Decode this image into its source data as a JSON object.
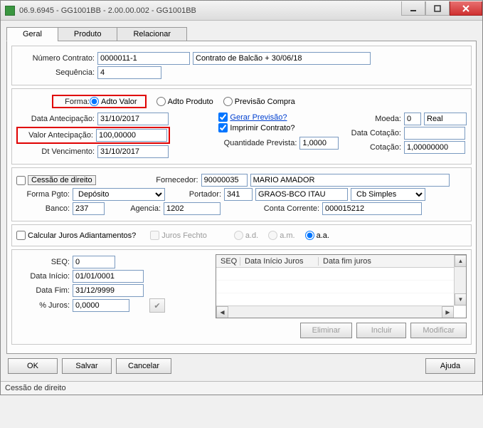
{
  "title": "06.9.6945 - GG1001BB - 2.00.00.002 - GG1001BB",
  "tabs": {
    "geral": "Geral",
    "produto": "Produto",
    "relacionar": "Relacionar"
  },
  "g1": {
    "numContratoLbl": "Número Contrato:",
    "numContrato": "0000011-1",
    "descContrato": "Contrato de Balcão + 30/06/18",
    "sequenciaLbl": "Sequência:",
    "sequencia": "4"
  },
  "forma": {
    "lbl": "Forma:",
    "adtoValor": "Adto Valor",
    "adtoProduto": "Adto Produto",
    "previsao": "Previsão Compra"
  },
  "g2": {
    "dataAntLbl": "Data Antecipação:",
    "dataAnt": "31/10/2017",
    "valorAntLbl": "Valor Antecipação:",
    "valorAnt": "100,00000",
    "dtVencLbl": "Dt Vencimento:",
    "dtVenc": "31/10/2017",
    "gerarPrev": "Gerar Previsão?",
    "imprimir": "Imprimir Contrato?",
    "qtdPrevLbl": "Quantidade Prevista:",
    "qtdPrev": "1,0000",
    "moedaLbl": "Moeda:",
    "moeda": "0",
    "moedaDesc": "Real",
    "dataCotLbl": "Data Cotação:",
    "dataCot": "",
    "cotacaoLbl": "Cotação:",
    "cotacao": "1,00000000"
  },
  "g3": {
    "cessao": "Cessão de direito",
    "fornLbl": "Fornecedor:",
    "fornCod": "90000035",
    "fornNome": "MARIO AMADOR",
    "formaPgtoLbl": "Forma Pgto:",
    "formaPgto": "Depósito",
    "portadorLbl": "Portador:",
    "portadorCod": "341",
    "portadorNome": "GRAOS-BCO ITAU",
    "cbSimples": "Cb Simples",
    "bancoLbl": "Banco:",
    "banco": "237",
    "agenciaLbl": "Agencia:",
    "agencia": "1202",
    "ccLbl": "Conta Corrente:",
    "cc": "000015212"
  },
  "g4": {
    "calcJuros": "Calcular Juros Adiantamentos?",
    "jurosFechto": "Juros Fechto",
    "ad": "a.d.",
    "am": "a.m.",
    "aa": "a.a."
  },
  "g5": {
    "seqLbl": "SEQ:",
    "seq": "0",
    "dataIniLbl": "Data Início:",
    "dataIni": "01/01/0001",
    "dataFimLbl": "Data Fim:",
    "dataFim": "31/12/9999",
    "pjurosLbl": "% Juros:",
    "pjuros": "0,0000"
  },
  "grid": {
    "h1": "SEQ",
    "h2": "Data Início Juros",
    "h3": "Data fim juros",
    "eliminar": "Eliminar",
    "incluir": "Incluir",
    "modificar": "Modificar"
  },
  "buttons": {
    "ok": "OK",
    "salvar": "Salvar",
    "cancelar": "Cancelar",
    "ajuda": "Ajuda"
  },
  "status": "Cessão de direito"
}
